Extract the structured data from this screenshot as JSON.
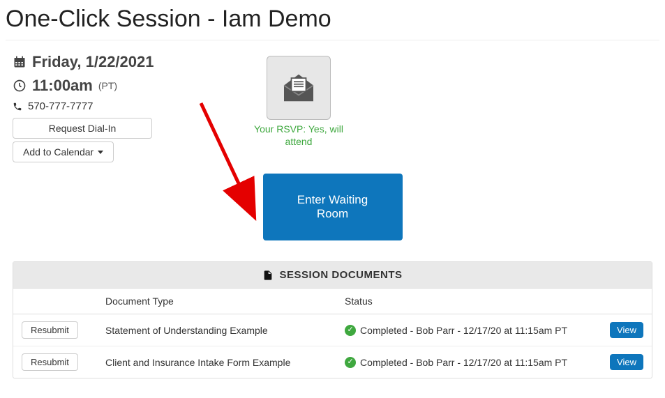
{
  "page": {
    "title": "One-Click Session - Iam Demo"
  },
  "session": {
    "date_label": "Friday, 1/22/2021",
    "time_label": "11:00am",
    "timezone_label": "(PT)",
    "phone": "570-777-7777",
    "request_dialin_label": "Request Dial-In",
    "add_to_calendar_label": "Add to Calendar",
    "rsvp_text": "Your RSVP: Yes, will attend",
    "enter_waiting_room_label": "Enter Waiting Room"
  },
  "documents": {
    "panel_title": "SESSION DOCUMENTS",
    "columns": {
      "action": "",
      "doc_type": "Document Type",
      "status": "Status",
      "view": ""
    },
    "resubmit_label": "Resubmit",
    "view_label": "View",
    "rows": [
      {
        "doc_type": "Statement of Understanding Example",
        "status": "Completed - Bob Parr - 12/17/20 at 11:15am PT"
      },
      {
        "doc_type": "Client and Insurance Intake Form Example",
        "status": "Completed - Bob Parr - 12/17/20 at 11:15am PT"
      }
    ]
  }
}
